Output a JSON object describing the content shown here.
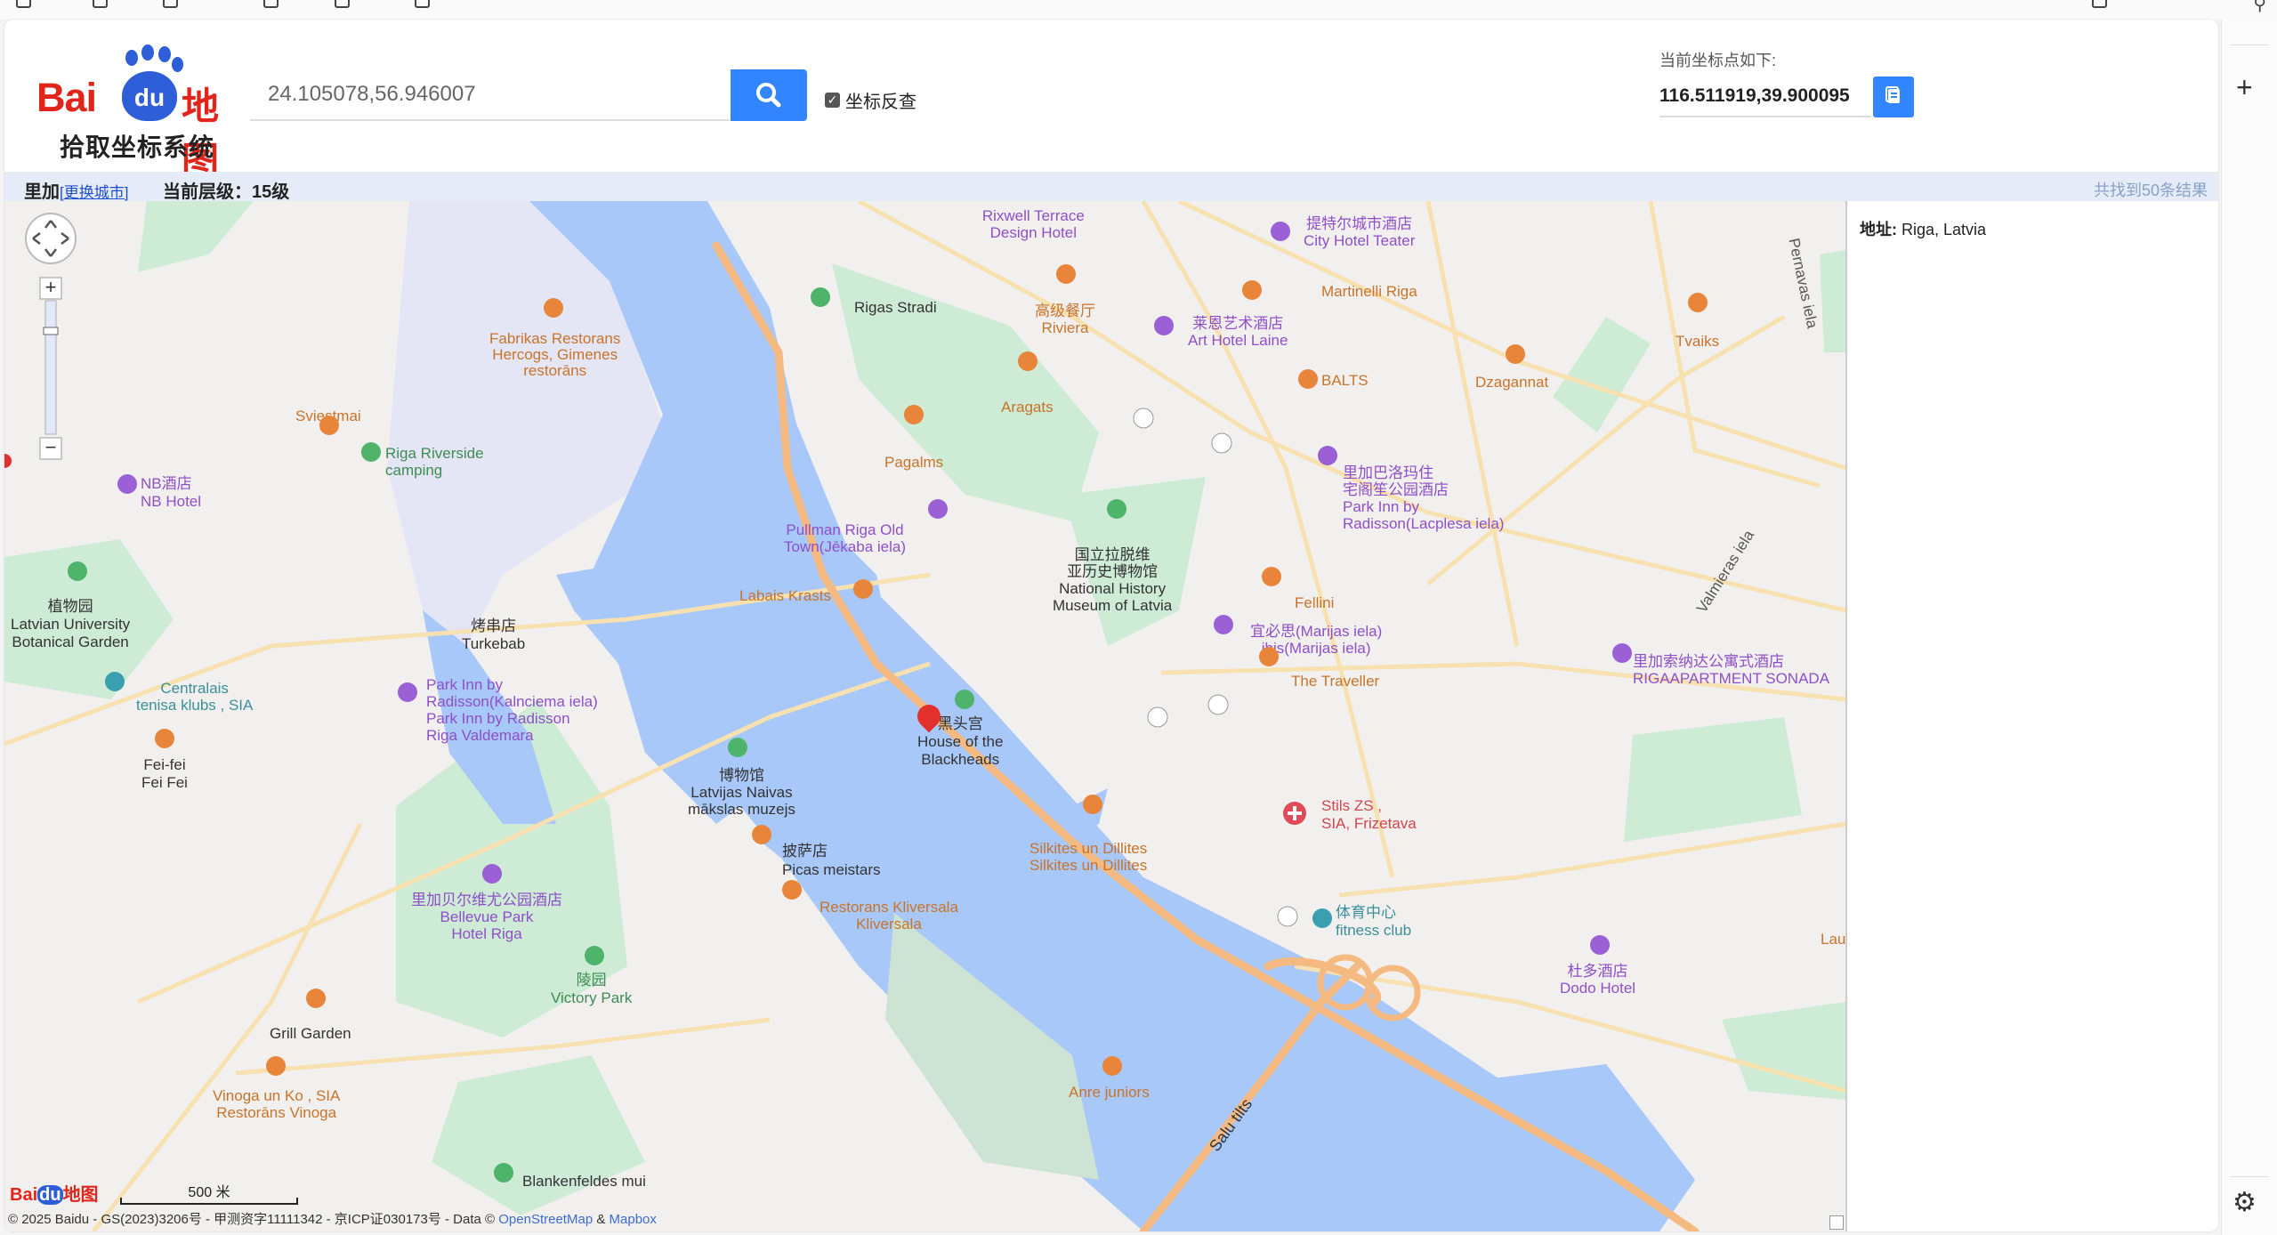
{
  "browser": {
    "search_icon": "search-icon",
    "rail_plus": "+",
    "rail_settings_icon": "gear-icon"
  },
  "header": {
    "logo_text": "Bai",
    "logo_du": "du",
    "logo_cn": "地图",
    "logo_sub": "拾取坐标系统",
    "search_value": "24.105078,56.946007",
    "reverse_label": "坐标反查",
    "coord_label": "当前坐标点如下:",
    "coord_value": "116.511919,39.900095"
  },
  "subbar": {
    "city": "里加",
    "change_city": "[更换城市]",
    "level_label": "当前层级：15级",
    "results": "共找到50条结果"
  },
  "side": {
    "addr_label": "地址:",
    "addr_value": "Riga, Latvia"
  },
  "map": {
    "accent": "#3385ff",
    "water": "#a8c8fa",
    "park": "#cdebd5",
    "road": "#f5b982",
    "labels": {
      "riga_stradi": "Rigas Stradi",
      "fabrikas": "Fabrikas Restorans\nHercogs, Gimenes\nrestorāns",
      "sviestmai": "Sviestmai",
      "riverside": "Riga Riverside\ncamping",
      "nb_hotel": "NB酒店\nNB Hotel",
      "botanical": "植物园\nLatvian University\nBotanical Garden",
      "centralais": "Centralais\ntenisa klubs , SIA",
      "feifei": "Fei-fei\nFei Fei",
      "turkebab": "烤串店\nTurkebab",
      "park_inn_k": "Park Inn by\nRadisson(Kalnciema iela)\nPark Inn by Radisson\nRiga Valdemara",
      "labais": "Labais Krasts",
      "pullman": "Pullman Riga Old\nTown(Jēkaba iela)",
      "pagalms": "Pagalms",
      "aragats": "Aragats",
      "riviera": "高级餐厅\nRiviera",
      "rixwell": "Riga Valdemara\nRixwell Terrace\nDesign Hotel",
      "teater": "提特尔城市酒店\nCity Hotel Teater",
      "martinelli": "Martinelli Riga",
      "laine": "莱恩艺术酒店\nArt Hotel Laine",
      "balts": "BALTS",
      "dzagannat": "Dzagannat",
      "tvaiks": "Tvaiks",
      "lacplesa": "里加巴洛玛住\n宅阁笙公园酒店\nPark Inn by\nRadisson(Lacplesa iela)",
      "museum": "国立拉脱维\n亚历史博物馆\nNational History\nMuseum of Latvia",
      "fellini": "Fellini",
      "ibis": "宜必思(Marijas iela)\nibis(Marijas iela)",
      "traveller": "The Traveller",
      "sonada": "里加索纳达公寓式酒店\nRIGAAPARTMENT SONADA",
      "blackheads": "黑头宫\nHouse of the\nBlackheads",
      "nb_museum": "博物馆\nLatvijas Naivas\nmākslas muzejs",
      "picas": "披萨店\nPicas meistars",
      "kliversala": "Restorans Kliversala\nKliversala",
      "silkites": "Silkites un Dillites\nSilkites un Dillites",
      "frizetava": "Stils ZS ,\nSIA, Frizetava",
      "fitness": "体育中心\nfitness club",
      "bellevue": "里加贝尔维尤公园酒店\nBellevue Park\nHotel Riga",
      "victory": "陵园\nVictory Park",
      "grill": "Grill Garden",
      "vinoga": "Vinoga un Ko , SIA\nRestorāns Vinoga",
      "anre": "Anre juniors",
      "dodo": "杜多酒店\nDodo Hotel",
      "blankenfeldes": "Blankenfeldes mui",
      "salu": "Salu tilts",
      "pernavas": "Pernavas iela",
      "valmieras": "Valmieras iela",
      "lau": "Lau"
    },
    "scale": "500 米"
  },
  "footer": {
    "copyright": "© 2025 Baidu - GS(2023)3206号 - 甲测资字11111342 - 京ICP证030173号 - Data ©",
    "osm": "OpenStreetMap",
    "amp": "&",
    "mapbox": "Mapbox"
  }
}
